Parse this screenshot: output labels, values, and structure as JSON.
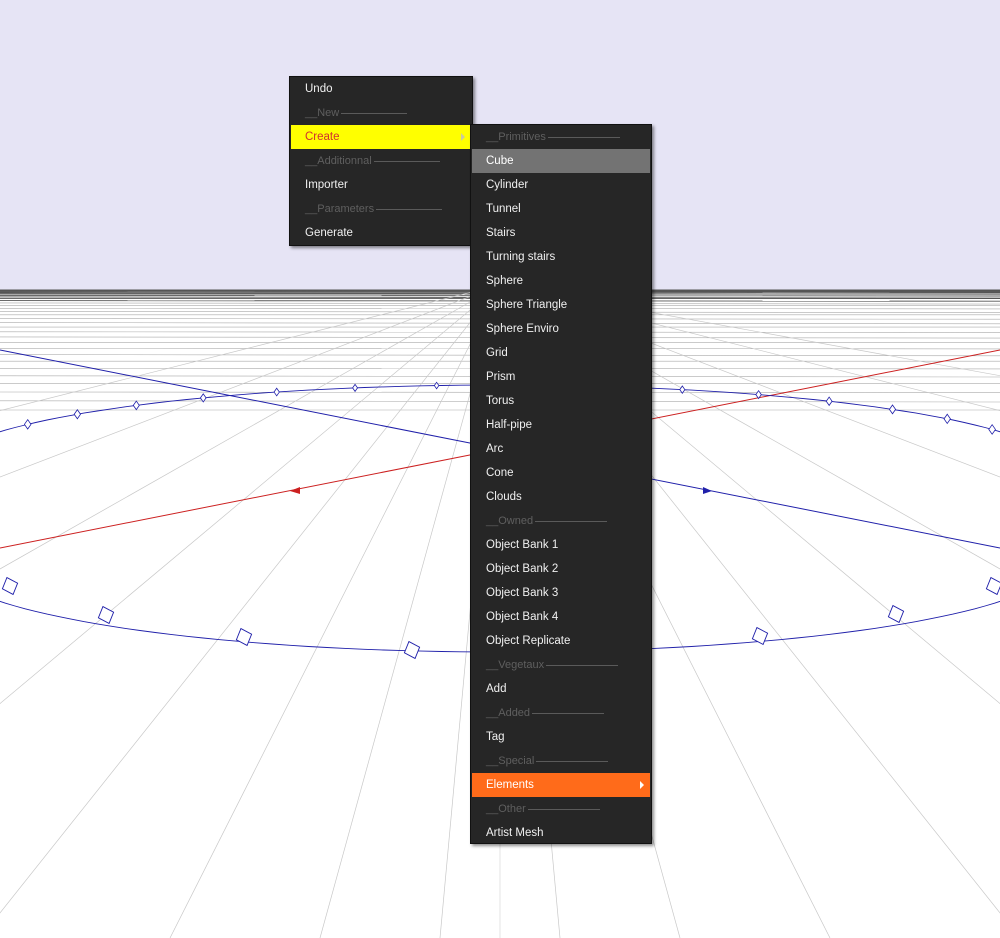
{
  "colors": {
    "sky": "#e6e4f5",
    "ground": "#ffffff",
    "grid_line": "#c8c8c8",
    "axis_red": "#cc2020",
    "path_blue": "#2020aa",
    "menu_bg": "#262626",
    "selected_bg": "#ffff00",
    "selected_text": "#d03030",
    "hover_bg": "#737373",
    "accent_orange": "#ff6b1a"
  },
  "context_menu": {
    "items": [
      {
        "label": "Undo",
        "kind": "item"
      },
      {
        "label": "__New",
        "kind": "separator"
      },
      {
        "label": "Create",
        "kind": "item",
        "state": "selected",
        "submenu": true
      },
      {
        "label": "__Additionnal",
        "kind": "separator"
      },
      {
        "label": "Importer",
        "kind": "item"
      },
      {
        "label": "__Parameters",
        "kind": "separator"
      },
      {
        "label": "Generate",
        "kind": "item"
      }
    ]
  },
  "create_submenu": {
    "items": [
      {
        "label": "__Primitives",
        "kind": "separator"
      },
      {
        "label": "Cube",
        "kind": "item",
        "state": "hover"
      },
      {
        "label": "Cylinder",
        "kind": "item"
      },
      {
        "label": "Tunnel",
        "kind": "item"
      },
      {
        "label": "Stairs",
        "kind": "item"
      },
      {
        "label": "Turning stairs",
        "kind": "item"
      },
      {
        "label": "Sphere",
        "kind": "item"
      },
      {
        "label": "Sphere Triangle",
        "kind": "item"
      },
      {
        "label": "Sphere Enviro",
        "kind": "item"
      },
      {
        "label": "Grid",
        "kind": "item"
      },
      {
        "label": "Prism",
        "kind": "item"
      },
      {
        "label": "Torus",
        "kind": "item"
      },
      {
        "label": "Half-pipe",
        "kind": "item"
      },
      {
        "label": "Arc",
        "kind": "item"
      },
      {
        "label": "Cone",
        "kind": "item"
      },
      {
        "label": "Clouds",
        "kind": "item"
      },
      {
        "label": "__Owned",
        "kind": "separator"
      },
      {
        "label": "Object Bank 1",
        "kind": "item"
      },
      {
        "label": "Object Bank 2",
        "kind": "item"
      },
      {
        "label": "Object Bank 3",
        "kind": "item"
      },
      {
        "label": "Object Bank 4",
        "kind": "item"
      },
      {
        "label": "Object Replicate",
        "kind": "item"
      },
      {
        "label": "__Vegetaux",
        "kind": "separator"
      },
      {
        "label": "Add",
        "kind": "item"
      },
      {
        "label": "__Added",
        "kind": "separator"
      },
      {
        "label": "Tag",
        "kind": "item"
      },
      {
        "label": "__Special",
        "kind": "separator"
      },
      {
        "label": "Elements",
        "kind": "item",
        "state": "highlighted",
        "submenu": true
      },
      {
        "label": "__Other",
        "kind": "separator"
      },
      {
        "label": "Artist Mesh",
        "kind": "item"
      }
    ]
  }
}
